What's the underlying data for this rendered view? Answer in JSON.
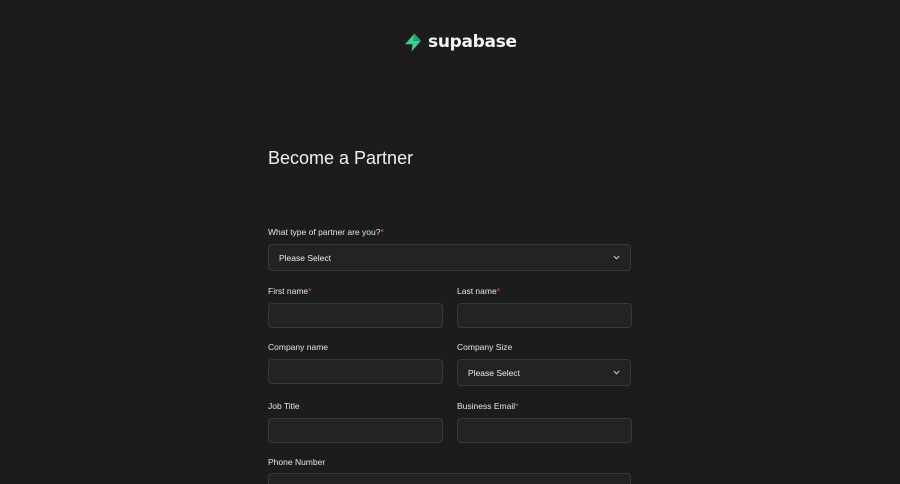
{
  "brand": {
    "name": "supabase",
    "accent": "#3ecf8e"
  },
  "page": {
    "title": "Become a Partner"
  },
  "form": {
    "required_marker": "*",
    "partner_type": {
      "label": "What type of partner are you?",
      "value": "Please Select"
    },
    "first_name": {
      "label": "First name",
      "value": ""
    },
    "last_name": {
      "label": "Last name",
      "value": ""
    },
    "company_name": {
      "label": "Company name",
      "value": ""
    },
    "company_size": {
      "label": "Company Size",
      "value": "Please Select"
    },
    "job_title": {
      "label": "Job Title",
      "value": ""
    },
    "business_email": {
      "label": "Business Email",
      "value": ""
    },
    "phone_number": {
      "label": "Phone Number",
      "value": ""
    }
  },
  "icons": {
    "logo": "supabase-bolt-icon",
    "dropdown": "chevron-down-icon"
  }
}
